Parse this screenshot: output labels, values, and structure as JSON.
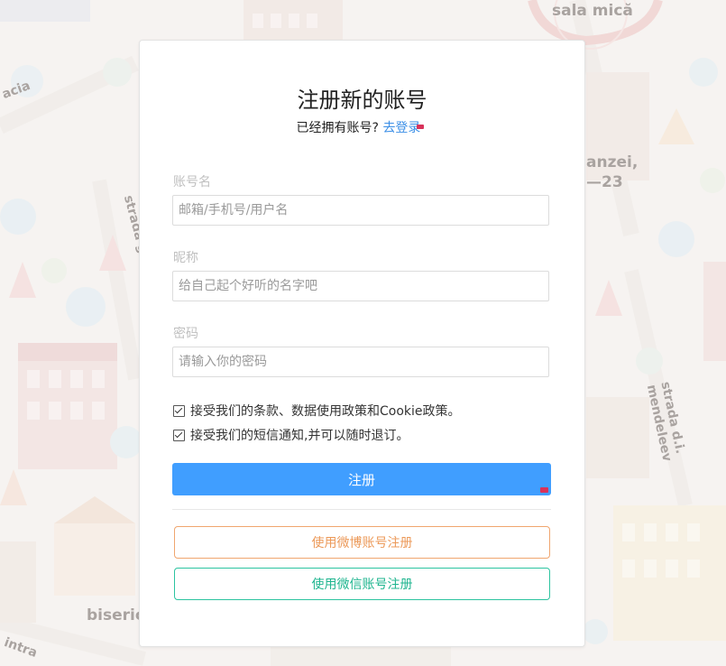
{
  "background": {
    "map_labels": [
      "sala mică",
      "acia",
      "strada gen",
      "anzei,",
      "—23",
      "strada d.i. mendeleev",
      "biseric",
      "intra"
    ]
  },
  "form": {
    "title": "注册新的账号",
    "subtitle_text": "已经拥有账号?",
    "login_link": "去登录",
    "fields": [
      {
        "label": "账号名",
        "placeholder": "邮箱/手机号/用户名",
        "value": ""
      },
      {
        "label": "昵称",
        "placeholder": "给自己起个好听的名字吧",
        "value": ""
      },
      {
        "label": "密码",
        "placeholder": "请输入你的密码",
        "value": ""
      }
    ],
    "agreements": [
      {
        "text": "接受我们的条款、数据使用政策和Cookie政策。",
        "checked": true
      },
      {
        "text": "接受我们的短信通知,并可以随时退订。",
        "checked": true
      }
    ],
    "submit_label": "注册",
    "weibo_label": "使用微博账号注册",
    "wechat_label": "使用微信账号注册"
  },
  "colors": {
    "primary": "#409eff",
    "link": "#3a8ee6",
    "weibo": "#ec9a5a",
    "wechat": "#1fb58f"
  }
}
